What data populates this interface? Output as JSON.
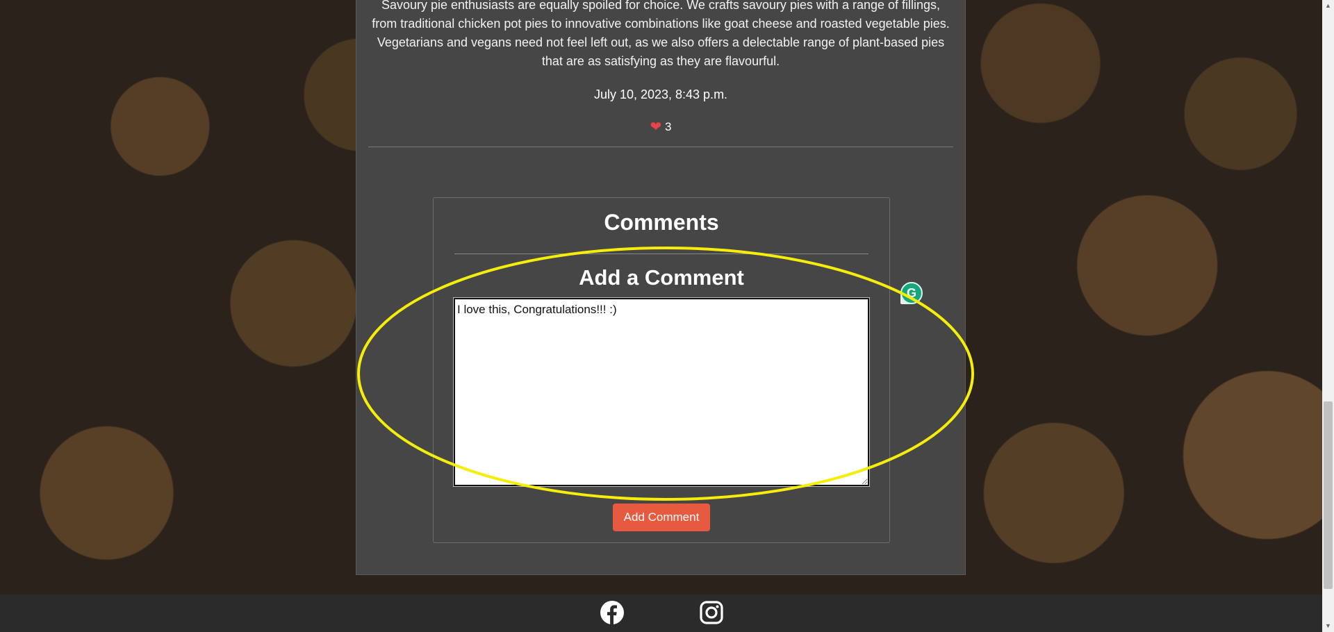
{
  "post": {
    "body_text": "Savoury pie enthusiasts are equally spoiled for choice. We crafts savoury pies with a range of fillings, from traditional chicken pot pies to innovative combinations like goat cheese and roasted vegetable pies. Vegetarians and vegans need not feel left out, as we also offers a delectable range of plant-based pies that are as satisfying as they are flavourful.",
    "date": "July 10, 2023, 8:43 p.m.",
    "likes_count": "3",
    "heart_icon": "heart-icon"
  },
  "comments": {
    "title": "Comments",
    "add_title": "Add a Comment",
    "input_value": "I love this, Congratulations!!! :)",
    "button_label": "Add Comment"
  },
  "overlay": {
    "grammarly_letter": "G",
    "highlight_color": "#f5ee0b"
  },
  "footer": {
    "social_icons": [
      "facebook-icon",
      "instagram-icon"
    ]
  },
  "colors": {
    "accent": "#e85a3f",
    "card": "#464646",
    "heart": "#e8424a"
  }
}
